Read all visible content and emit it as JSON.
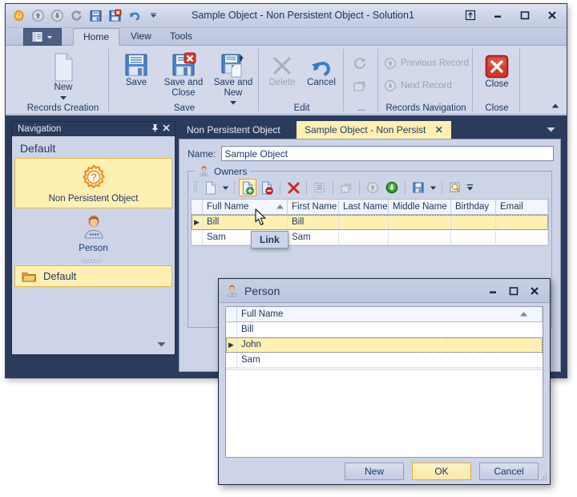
{
  "window": {
    "title": "Sample Object - Non Persistent Object - Solution1",
    "quick_access": [
      "settings-gear-icon",
      "move-up-icon",
      "move-down-icon",
      "refresh-icon",
      "save-icon",
      "save-close-icon",
      "undo-icon",
      "qat-dropdown-icon"
    ],
    "controls": [
      "restore-ribbon-icon",
      "minimize-icon",
      "maximize-icon",
      "close-icon"
    ]
  },
  "ribbon": {
    "app_button": "app-menu-icon",
    "tabs": [
      {
        "label": "Home",
        "active": true
      },
      {
        "label": "View",
        "active": false
      },
      {
        "label": "Tools",
        "active": false
      }
    ],
    "groups": [
      {
        "caption": "Records Creation",
        "buttons": [
          {
            "label": "New",
            "enabled": true,
            "dropdown": true
          }
        ]
      },
      {
        "caption": "Save",
        "buttons": [
          {
            "label": "Save",
            "enabled": true,
            "dropdown": false
          },
          {
            "label": "Save and Close",
            "enabled": true,
            "dropdown": false
          },
          {
            "label": "Save and New",
            "enabled": true,
            "dropdown": true
          }
        ]
      },
      {
        "caption": "Edit",
        "buttons": [
          {
            "label": "Delete",
            "enabled": false,
            "dropdown": false
          },
          {
            "label": "Cancel",
            "enabled": true,
            "dropdown": false
          }
        ]
      },
      {
        "caption": "...",
        "buttons": [
          {
            "label": "",
            "enabled": false,
            "icon": "refresh-small-icon"
          },
          {
            "label": "",
            "enabled": false,
            "icon": "restore-small-icon"
          }
        ]
      },
      {
        "caption": "Records Navigation",
        "buttons": [
          {
            "label": "Previous Record",
            "enabled": false
          },
          {
            "label": "Next Record",
            "enabled": false
          }
        ]
      },
      {
        "caption": "Close",
        "buttons": [
          {
            "label": "Close",
            "enabled": true,
            "dropdown": false
          }
        ]
      }
    ],
    "collapse_icon": "collapse-ribbon-icon"
  },
  "navigation": {
    "caption": "Navigation",
    "pin_icon": "pin-icon",
    "close_icon": "close-icon",
    "header": "Default",
    "items": [
      {
        "label": "Non Persistent Object",
        "icon": "gear-question-icon",
        "selected": true
      },
      {
        "label": "Person",
        "icon": "person-icon",
        "selected": false
      }
    ],
    "groups": [
      {
        "label": "Default",
        "icon": "folder-icon",
        "selected": true
      }
    ],
    "overflow_icon": "chevron-down-icon"
  },
  "document_tabs": {
    "tabs": [
      {
        "label": "Non Persistent Object",
        "active": false,
        "closable": false
      },
      {
        "label": "Sample Object - Non Persist",
        "active": true,
        "closable": true
      }
    ],
    "menu_icon": "chevron-down-icon"
  },
  "form": {
    "name_label": "Name:",
    "name_value": "Sample Object",
    "name_placeholder": "",
    "group": {
      "legend": "Owners",
      "legend_icon": "person-icon",
      "toolbar": [
        {
          "name": "new-object-button",
          "icon": "new-doc-icon",
          "enabled": true,
          "dropdown": true,
          "highlighted": false
        },
        {
          "name": "link-button",
          "icon": "link-icon",
          "enabled": true,
          "dropdown": false,
          "highlighted": true
        },
        {
          "name": "unlink-button",
          "icon": "unlink-icon",
          "enabled": true,
          "dropdown": false,
          "highlighted": false
        },
        {
          "name": "delete-button",
          "icon": "delete-x-icon",
          "enabled": true,
          "dropdown": false,
          "highlighted": false
        },
        {
          "name": "inline-edit-button",
          "icon": "inline-edit-icon",
          "enabled": false,
          "dropdown": false,
          "highlighted": false
        },
        {
          "name": "detail-view-button",
          "icon": "open-window-icon",
          "enabled": false,
          "dropdown": false,
          "highlighted": false
        },
        {
          "name": "move-up-button",
          "icon": "arrow-up-circle-icon",
          "enabled": false,
          "dropdown": false,
          "highlighted": false
        },
        {
          "name": "move-down-button",
          "icon": "arrow-down-circle-icon",
          "enabled": true,
          "dropdown": false,
          "highlighted": false
        },
        {
          "name": "export-button",
          "icon": "export-icon",
          "enabled": true,
          "dropdown": true,
          "highlighted": false
        },
        {
          "name": "filter-button",
          "icon": "search-filter-icon",
          "enabled": true,
          "dropdown": true,
          "highlighted": false
        }
      ],
      "grid": {
        "columns": [
          "Full Name",
          "First Name",
          "Last Name",
          "Middle Name",
          "Birthday",
          "Email"
        ],
        "sort_column": "Full Name",
        "sort_direction": "asc",
        "rows": [
          {
            "selected": true,
            "cells": [
              "Bill",
              "Bill",
              "",
              "",
              "",
              ""
            ]
          },
          {
            "selected": false,
            "cells": [
              "Sam",
              "Sam",
              "",
              "",
              "",
              ""
            ]
          }
        ]
      }
    }
  },
  "tooltip": {
    "text": "Link"
  },
  "dialog": {
    "title": "Person",
    "title_icon": "person-icon",
    "controls": [
      "minimize-icon",
      "maximize-icon",
      "close-icon"
    ],
    "grid": {
      "columns": [
        "Full Name"
      ],
      "sort_column": "Full Name",
      "sort_direction": "asc",
      "rows": [
        {
          "selected": false,
          "cells": [
            "Bill"
          ]
        },
        {
          "selected": true,
          "cells": [
            "John"
          ]
        },
        {
          "selected": false,
          "cells": [
            "Sam"
          ]
        }
      ]
    },
    "buttons": [
      {
        "label": "New",
        "default": false
      },
      {
        "label": "OK",
        "default": true
      },
      {
        "label": "Cancel",
        "default": false
      }
    ]
  },
  "colors": {
    "accent_dark": "#2b3b5c",
    "panel": "#cdd4e8",
    "selection_yellow": "#fdf0b2",
    "selection_border": "#e3b94a",
    "text": "#1f3864"
  }
}
